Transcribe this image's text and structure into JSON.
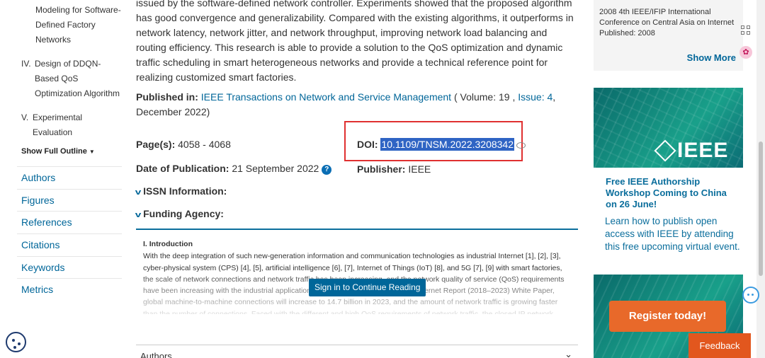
{
  "outline": {
    "items": [
      {
        "num": "",
        "lines": [
          "Modeling for Software-",
          "Defined Factory",
          "Networks"
        ]
      },
      {
        "num": "IV.",
        "lines": [
          "Design of DDQN-",
          "Based QoS",
          "Optimization Algorithm"
        ]
      },
      {
        "num": "V.",
        "lines": [
          "Experimental",
          "Evaluation"
        ]
      }
    ],
    "show_full": "Show Full Outline"
  },
  "nav": [
    "Authors",
    "Figures",
    "References",
    "Citations",
    "Keywords",
    "Metrics"
  ],
  "abstract": "issued by the software-defined network controller. Experiments showed that the proposed algorithm has good convergence and generalizability. Compared with the existing algorithms, it outperforms in network latency, network jitter, and network throughput, improving network load balancing and routing efficiency. This research is able to provide a solution to the QoS optimization and dynamic traffic scheduling in smart heterogeneous networks and provide a technical reference point for realizing customized smart factories.",
  "published": {
    "label": "Published in:",
    "journal": "IEEE Transactions on Network and Service Management",
    "volume_prefix": " ( Volume: 19 , ",
    "issue": "Issue: 4",
    "date_suffix": ", December 2022)"
  },
  "pages": {
    "label": "Page(s):",
    "value": "4058 - 4068"
  },
  "date_of_publication": {
    "label": "Date of Publication:",
    "value": "21 September 2022"
  },
  "doi": {
    "label": "DOI:",
    "value": "10.1109/TNSM.2022.3208342"
  },
  "publisher": {
    "label": "Publisher:",
    "value": "IEEE"
  },
  "accordions": [
    "ISSN Information:",
    "Funding Agency:"
  ],
  "intro": {
    "heading": "I. Introduction",
    "text": "With the deep integration of such new-generation information and communication technologies as industrial Internet [1], [2], [3], cyber-physical system (CPS) [4], [5], artificial intelligence [6], [7], Internet of Things (IoT) [8], and 5G [7], [9] with smart factories, the scale of network connections and network traffic has been increasing, and the network quality of service (QoS) requirements have been increasing with the industrial application. According to the Cisco Annual Internet Report (2018–2023) White Paper, global machine-to-machine connections will increase to 14.7 billion in 2023, and the amount of network traffic is growing faster than the number of connections. Faced with the different and high QoS requirements of network traffic, the closed IP network architecture"
  },
  "signin_label": "Sign in to Continue Reading",
  "authors_section": "Authors",
  "sidebar": {
    "conf_line1": "2008 4th IEEE/IFIP International Conference on Central Asia on Internet",
    "conf_published": "Published: 2008",
    "show_more": "Show More",
    "ieee_logo": "IEEE",
    "ad_title": "Free IEEE Authorship Workshop Coming to China on 26 June!",
    "ad_body": "Learn how to publish open access with IEEE by attending this free upcoming virtual event.",
    "register_label": "Register today!"
  },
  "feedback_label": "Feedback"
}
